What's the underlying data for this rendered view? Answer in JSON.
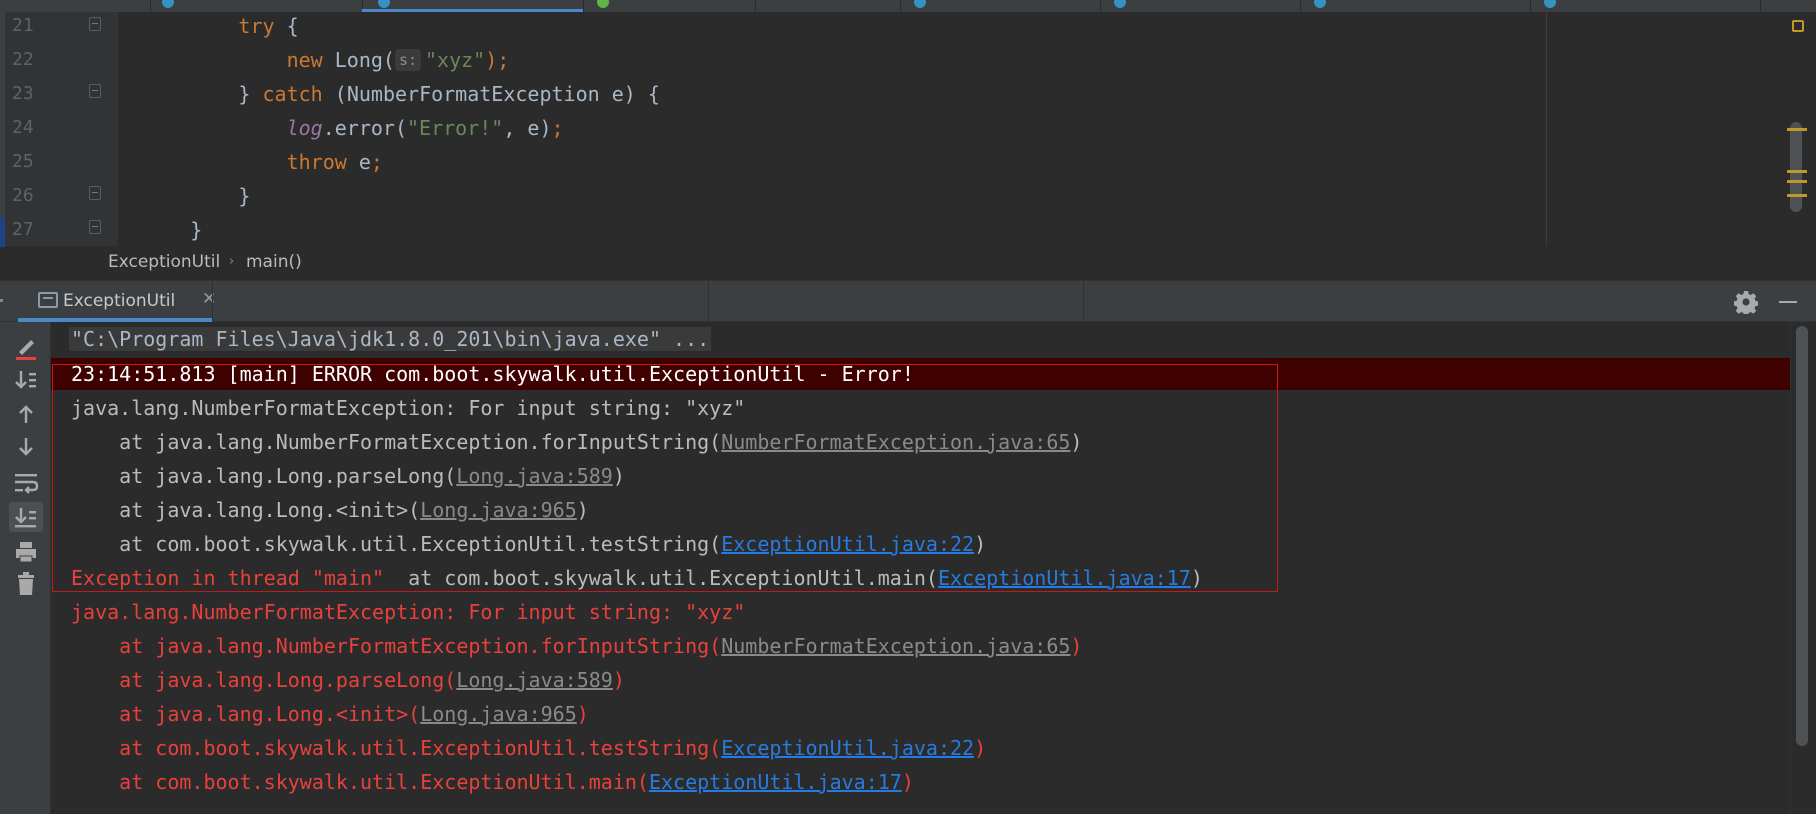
{
  "editor": {
    "line_numbers": [
      "21",
      "22",
      "23",
      "24",
      "25",
      "26",
      "27"
    ],
    "code": {
      "l21_kw": "try",
      "l21_rest": " {",
      "l22_kw": "new",
      "l22_cls": " Long(",
      "l22_hint": "s:",
      "l22_str": "\"xyz\"",
      "l22_end": ");",
      "l23_brace": "} ",
      "l23_kw": "catch",
      "l23_rest": " (NumberFormatException e) {",
      "l24_field": "log",
      "l24_call": ".error(",
      "l24_str": "\"Error!\"",
      "l24_rest": ", e)",
      "l24_semi": ";",
      "l25_kw": "throw",
      "l25_rest": " e",
      "l25_semi": ";",
      "l26": "}",
      "l27": "}"
    }
  },
  "breadcrumb": {
    "class_name": "ExceptionUtil",
    "separator": "›",
    "method": "main()"
  },
  "run_window": {
    "tab_label": "ExceptionUtil",
    "close_glyph": "✕"
  },
  "console": {
    "command": "\"C:\\Program Files\\Java\\jdk1.8.0_201\\bin\\java.exe\" ...",
    "log_line": "23:14:51.813 [main] ERROR com.boot.skywalk.util.ExceptionUtil - Error!",
    "exc_msg": "java.lang.NumberFormatException: For input string: \"xyz\"",
    "trace1_prefix": "    at java.lang.NumberFormatException.forInputString(",
    "trace1_link": "NumberFormatException.java:65",
    "trace2_prefix": "    at java.lang.Long.parseLong(",
    "trace2_link": "Long.java:589",
    "trace3_prefix": "    at java.lang.Long.<init>(",
    "trace3_link": "Long.java:965",
    "trace4_prefix": "    at com.boot.skywalk.util.ExceptionUtil.testString(",
    "trace4_link": "ExceptionUtil.java:22",
    "thread_text": "Exception in thread \"main\"",
    "trace5_mid": "  at com.boot.skywalk.util.ExceptionUtil.main(",
    "trace5_link": "ExceptionUtil.java:17",
    "trace5_main_prefix": "    at com.boot.skywalk.util.ExceptionUtil.main(",
    "close_paren": ")"
  },
  "colors": {
    "background": "#2b2b2b",
    "keyword": "#cc7832",
    "string": "#6a8759",
    "error_red": "#e8413c",
    "link_blue": "#287bde",
    "highlight_box": "#c21b1b"
  }
}
